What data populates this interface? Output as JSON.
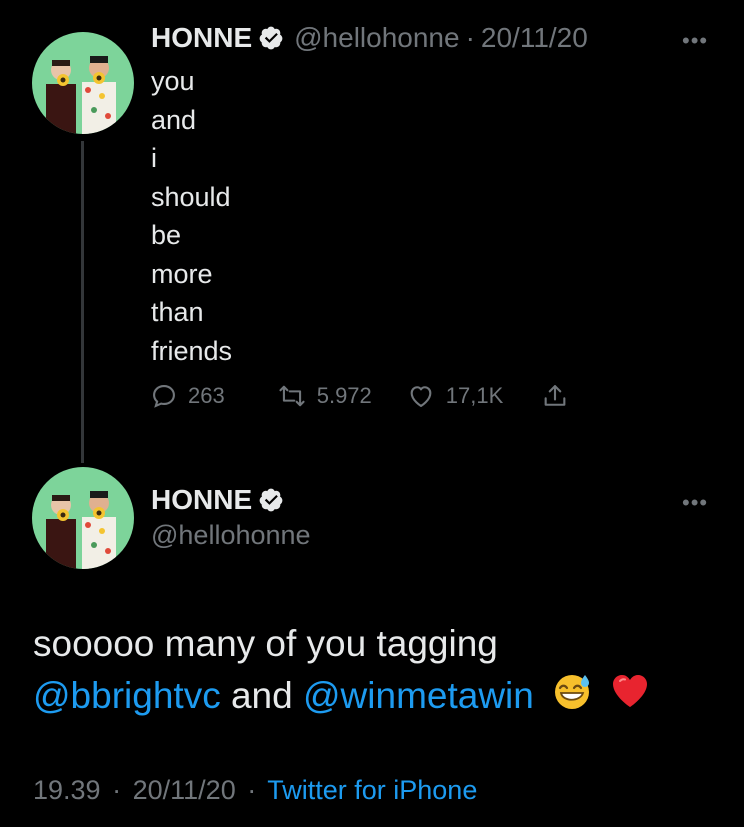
{
  "colors": {
    "background": "#000000",
    "text": "#e7e9ea",
    "secondary": "#71767b",
    "link": "#1d9bf0",
    "avatar_bg": "#7dd49a"
  },
  "parent_tweet": {
    "display_name": "HONNE",
    "handle": "@hellohonne",
    "separator": "·",
    "date": "20/11/20",
    "lines": [
      "you",
      "and",
      "i",
      "should",
      "be",
      "more",
      "than",
      "friends"
    ],
    "actions": {
      "replies": "263",
      "retweets": "5.972",
      "likes": "17,1K"
    },
    "icons": [
      "verified-badge-icon",
      "more-icon",
      "reply-icon",
      "retweet-icon",
      "like-icon",
      "share-icon"
    ]
  },
  "main_tweet": {
    "display_name": "HONNE",
    "handle": "@hellohonne",
    "text_part1": "sooooo many of you tagging",
    "mention1": "@bbrightvc",
    "connector": " and ",
    "mention2": "@winmetawin",
    "emojis": [
      "sweat-smile-emoji",
      "red-heart-emoji"
    ],
    "time": "19.39",
    "date": "20/11/20",
    "dot": "·",
    "source": "Twitter for iPhone"
  }
}
